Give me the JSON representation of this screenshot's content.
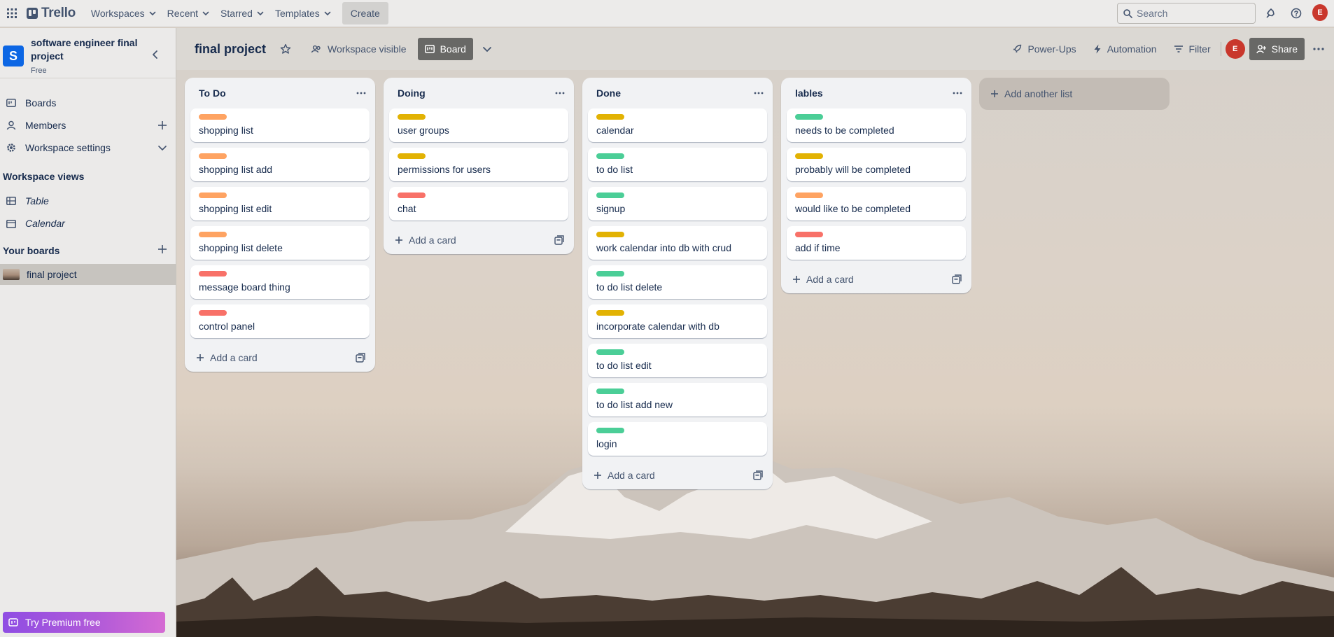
{
  "topnav": {
    "logo": "Trello",
    "menus": [
      {
        "label": "Workspaces"
      },
      {
        "label": "Recent"
      },
      {
        "label": "Starred"
      },
      {
        "label": "Templates"
      }
    ],
    "create_label": "Create",
    "search_placeholder": "Search",
    "avatar_initial": "E"
  },
  "sidebar": {
    "workspace_initial": "S",
    "workspace_name": "software engineer final project",
    "workspace_plan": "Free",
    "items": [
      {
        "label": "Boards"
      },
      {
        "label": "Members"
      },
      {
        "label": "Workspace settings"
      }
    ],
    "views_heading": "Workspace views",
    "views": [
      {
        "label": "Table"
      },
      {
        "label": "Calendar"
      }
    ],
    "boards_heading": "Your boards",
    "boards": [
      {
        "label": "final project"
      }
    ],
    "premium_label": "Try Premium free"
  },
  "board": {
    "title": "final project",
    "visibility": "Workspace visible",
    "view_label": "Board",
    "powerups_label": "Power-Ups",
    "automation_label": "Automation",
    "filter_label": "Filter",
    "avatar_initial": "E",
    "share_label": "Share",
    "add_list_label": "Add another list",
    "add_card_label": "Add a card",
    "label_colors": {
      "orange": "#fea362",
      "yellow": "#e2b203",
      "red": "#f87168",
      "green": "#4bce97"
    },
    "lists": [
      {
        "title": "To Do",
        "cards": [
          {
            "title": "shopping list",
            "label": "orange"
          },
          {
            "title": "shopping list add",
            "label": "orange"
          },
          {
            "title": "shopping list edit",
            "label": "orange"
          },
          {
            "title": "shopping list delete",
            "label": "orange"
          },
          {
            "title": "message board thing",
            "label": "red"
          },
          {
            "title": "control panel",
            "label": "red"
          }
        ]
      },
      {
        "title": "Doing",
        "cards": [
          {
            "title": "user groups",
            "label": "yellow"
          },
          {
            "title": "permissions for users",
            "label": "yellow"
          },
          {
            "title": "chat",
            "label": "red"
          }
        ]
      },
      {
        "title": "Done",
        "cards": [
          {
            "title": "calendar",
            "label": "yellow"
          },
          {
            "title": "to do list",
            "label": "green"
          },
          {
            "title": "signup",
            "label": "green"
          },
          {
            "title": "work calendar into db with crud",
            "label": "yellow"
          },
          {
            "title": "to do list delete",
            "label": "green"
          },
          {
            "title": "incorporate calendar with db",
            "label": "yellow"
          },
          {
            "title": "to do list edit",
            "label": "green"
          },
          {
            "title": "to do list add new",
            "label": "green"
          },
          {
            "title": "login",
            "label": "green"
          }
        ]
      },
      {
        "title": "lables",
        "cards": [
          {
            "title": "needs to be completed",
            "label": "green"
          },
          {
            "title": "probably will be completed",
            "label": "yellow"
          },
          {
            "title": "would like to be completed",
            "label": "orange"
          },
          {
            "title": "add if time",
            "label": "red"
          }
        ]
      }
    ]
  }
}
